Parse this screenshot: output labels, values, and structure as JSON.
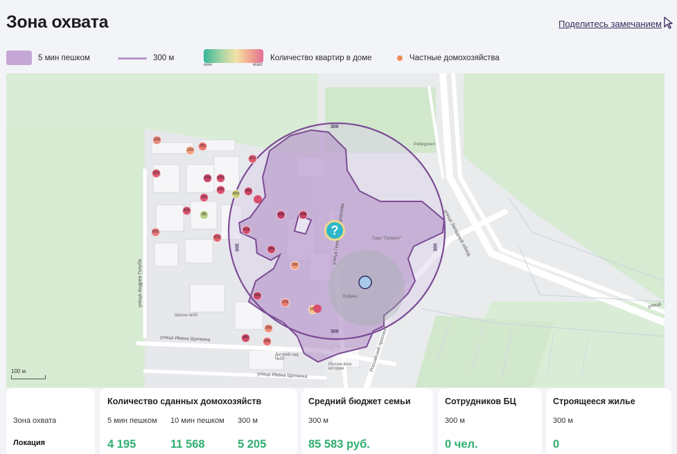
{
  "header": {
    "title": "Зона охвата",
    "share_link": "Поделитесь замечанием"
  },
  "legend": {
    "walk_zone": "5 мин пешком",
    "radius": "300 м",
    "gradient_min": "мин",
    "gradient_max": "макс",
    "apartments": "Количество квартир в доме",
    "private": "Частные домохозяйства"
  },
  "colors": {
    "zone_fill": "#c4a7d5",
    "zone_stroke": "#7b4b94",
    "accent_green": "#2fae70",
    "private_orange": "#f08a52"
  },
  "map": {
    "scale_label": "100 м",
    "ring_labels": [
      "300",
      "300",
      "300",
      "300"
    ],
    "street_labels": {
      "zapadny": "улица Западный обход",
      "gen_margelova": "улица Генерала Маргелова",
      "shchepkina": "улица Ивана Щепкина",
      "shchepkina2": "улица Ивана Щепкина",
      "golubya": "улица Андрея Голубя",
      "rossiyskiy": "Российский проспект",
      "ulitsa_right": "улица"
    },
    "poi": {
      "pellegreen": "Pellegreen",
      "park": "Парк \"Патриот\"",
      "kofiks": "Кофикс",
      "school": "Школа №55",
      "kindergarten": "Детский сад №30",
      "russia_history": "Россия-Моя история"
    },
    "houses": [
      {
        "value": "233",
        "color": "#e58a7a"
      },
      {
        "value": "233",
        "color": "#f3a17e"
      },
      {
        "value": "251",
        "color": "#e8766c"
      },
      {
        "value": "833",
        "color": "#d9586e"
      },
      {
        "value": "560",
        "color": "#c9476a"
      },
      {
        "value": "833",
        "color": "#d24e6d"
      },
      {
        "value": "833",
        "color": "#d84e6e"
      },
      {
        "value": "417",
        "color": "#db5a6f"
      },
      {
        "value": "410",
        "color": "#c7ce7b"
      },
      {
        "value": "560",
        "color": "#cc4668"
      },
      {
        "value": "392",
        "color": "#d85774"
      },
      {
        "value": "431",
        "color": "#d2506c"
      },
      {
        "value": "85",
        "color": "#b9cf86"
      },
      {
        "value": "831",
        "color": "#e57a7a"
      },
      {
        "value": "833",
        "color": "#e0626f"
      },
      {
        "value": "424",
        "color": "#d24d6a"
      },
      {
        "value": "608",
        "color": "#c53f66"
      },
      {
        "value": "608",
        "color": "#c94468"
      },
      {
        "value": "564",
        "color": "#c9476a"
      },
      {
        "value": "260",
        "color": "#f29a7a"
      },
      {
        "value": "564",
        "color": "#c9476a"
      },
      {
        "value": "279",
        "color": "#e87e72"
      },
      {
        "value": "168",
        "color": "#f4c07e"
      },
      {
        "value": "266",
        "color": "#ef8c78"
      },
      {
        "value": "497",
        "color": "#cf4a6a"
      },
      {
        "value": "266",
        "color": "#e8706f"
      }
    ]
  },
  "stats": {
    "row_zone": "Зона охвата",
    "row_location": "Локация",
    "households": {
      "title": "Количество сданных домохозяйств",
      "cols": [
        {
          "label": "5 мин пешком",
          "value": "4 195"
        },
        {
          "label": "10 мин пешком",
          "value": "11 568"
        },
        {
          "label": "300 м",
          "value": "5 205"
        }
      ]
    },
    "budget": {
      "title": "Средний бюджет семьи",
      "label": "300 м",
      "value": "85 583 руб."
    },
    "employees": {
      "title": "Сотрудников БЦ",
      "label": "300 м",
      "value": "0 чел."
    },
    "construction": {
      "title": "Строящееся жилье",
      "label": "300 м",
      "value": "0"
    }
  }
}
